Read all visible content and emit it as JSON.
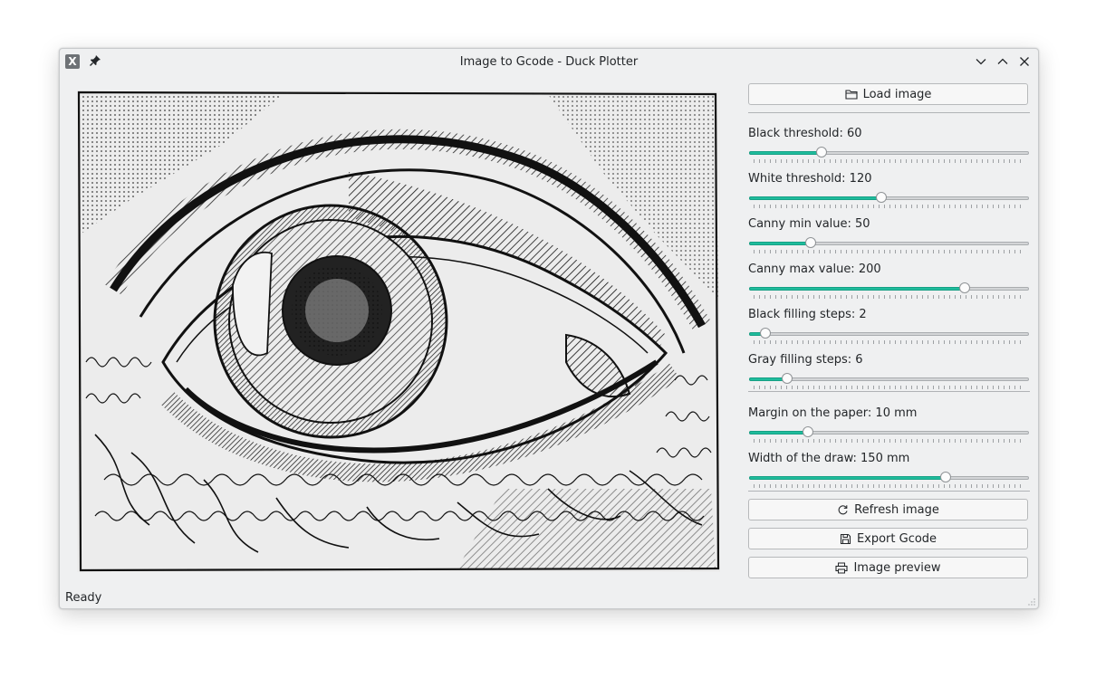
{
  "window": {
    "title": "Image to Gcode - Duck Plotter",
    "app_icon_glyph": "X",
    "icons": [
      "pin-icon",
      "minimize-icon",
      "maximize-icon",
      "close-icon"
    ]
  },
  "panel": {
    "load_label": "Load image",
    "refresh_label": "Refresh image",
    "export_label": "Export Gcode",
    "preview_label": "Image preview",
    "accent_color": "#1fbc9c",
    "sliders": [
      {
        "label": "Black threshold: 60",
        "fraction": 0.25
      },
      {
        "label": "White threshold: 120",
        "fraction": 0.47
      },
      {
        "label": "Canny min value: 50",
        "fraction": 0.21
      },
      {
        "label": "Canny max value: 200",
        "fraction": 0.78
      },
      {
        "label": "Black filling steps: 2",
        "fraction": 0.04
      },
      {
        "label": "Gray filling steps: 6",
        "fraction": 0.12
      },
      {
        "label": "Margin on the paper: 10 mm",
        "fraction": 0.2
      },
      {
        "label": "Width of the draw: 150 mm",
        "fraction": 0.71
      }
    ]
  },
  "status": {
    "text": "Ready"
  }
}
